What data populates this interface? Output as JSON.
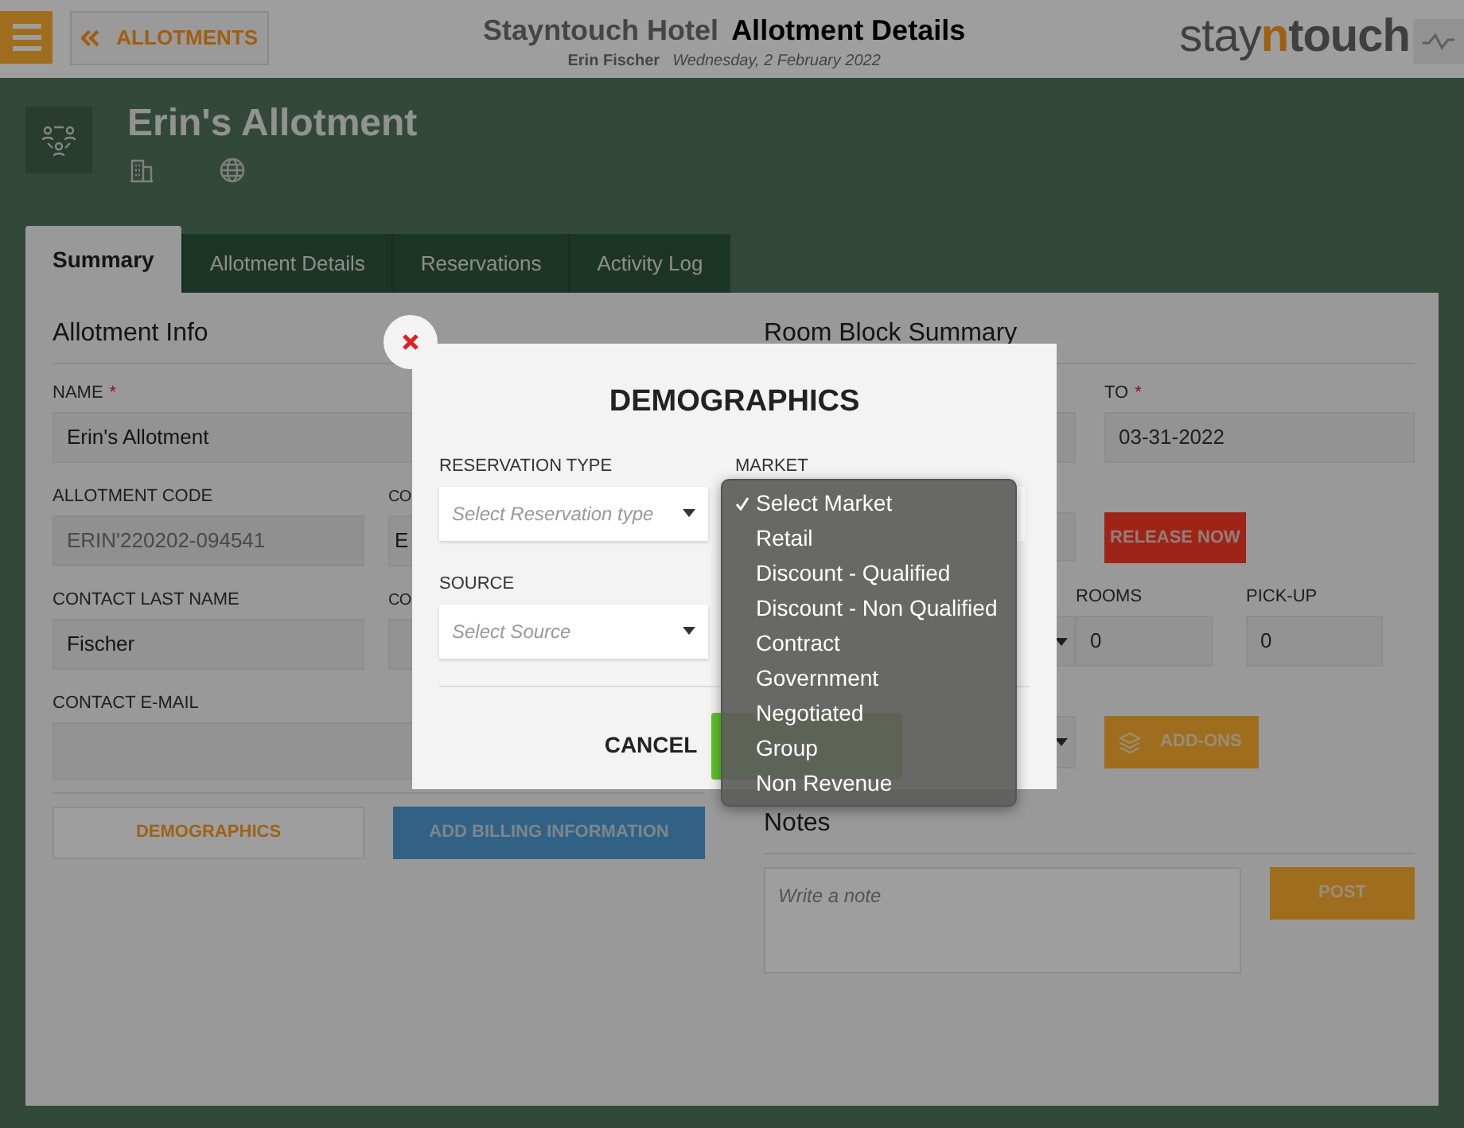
{
  "header": {
    "back_button": "ALLOTMENTS",
    "hotel": "Stayntouch Hotel",
    "page_title": "Allotment Details",
    "user": "Erin Fischer",
    "date": "Wednesday, 2 February 2022",
    "logo": {
      "before": "stay",
      "accent": "n",
      "after": "touch"
    }
  },
  "allotment": {
    "name": "Erin's Allotment"
  },
  "tabs": [
    {
      "label": "Summary",
      "selected": true
    },
    {
      "label": "Allotment Details",
      "selected": false
    },
    {
      "label": "Reservations",
      "selected": false
    },
    {
      "label": "Activity Log",
      "selected": false
    }
  ],
  "allotment_info": {
    "title": "Allotment Info",
    "name_field": {
      "label": "NAME",
      "required_mark": "*",
      "value": "Erin's Allotment"
    },
    "rows": [
      {
        "left": {
          "label": "ALLOTMENT CODE",
          "value": "ERIN'220202-094541",
          "disabled": true
        },
        "right": {
          "label": "CO",
          "value": "E"
        }
      },
      {
        "left": {
          "label": "CONTACT LAST NAME",
          "value": "Fischer",
          "disabled": false
        },
        "right": {
          "label": "CO"
        }
      }
    ],
    "email_field": {
      "label": "CONTACT E-MAIL"
    },
    "buttons": [
      {
        "kind": "plain",
        "label": "DEMOGRAPHICS"
      },
      {
        "kind": "billing",
        "label": "ADD BILLING INFORMATION"
      }
    ]
  },
  "room_block": {
    "title": "Room Block Summary",
    "to_field": {
      "label": "TO",
      "required_mark": "*",
      "value": "03-31-2022"
    },
    "release_button": "RELEASE NOW",
    "rooms": {
      "label": "ROOMS",
      "value": "0"
    },
    "pickup": {
      "label": "PICK-UP",
      "value": "0"
    },
    "addons_button": "ADD-ONS"
  },
  "notes": {
    "title": "Notes",
    "placeholder": "Write a note",
    "post_button": "POST"
  },
  "modal": {
    "title": "DEMOGRAPHICS",
    "fields": [
      {
        "label": "RESERVATION TYPE",
        "placeholder": "Select Reservation type"
      },
      {
        "label": "SOURCE",
        "placeholder": "Select Source"
      }
    ],
    "market_label": "MARKET",
    "market_options": [
      {
        "label": "Select Market",
        "selected": true
      },
      {
        "label": "Retail",
        "selected": false
      },
      {
        "label": "Discount - Qualified",
        "selected": false
      },
      {
        "label": "Discount - Non Qualified",
        "selected": false
      },
      {
        "label": "Contract",
        "selected": false
      },
      {
        "label": "Government",
        "selected": false
      },
      {
        "label": "Negotiated",
        "selected": false
      },
      {
        "label": "Group",
        "selected": false
      },
      {
        "label": "Non Revenue",
        "selected": false
      }
    ],
    "cancel_button": "CANCEL"
  }
}
